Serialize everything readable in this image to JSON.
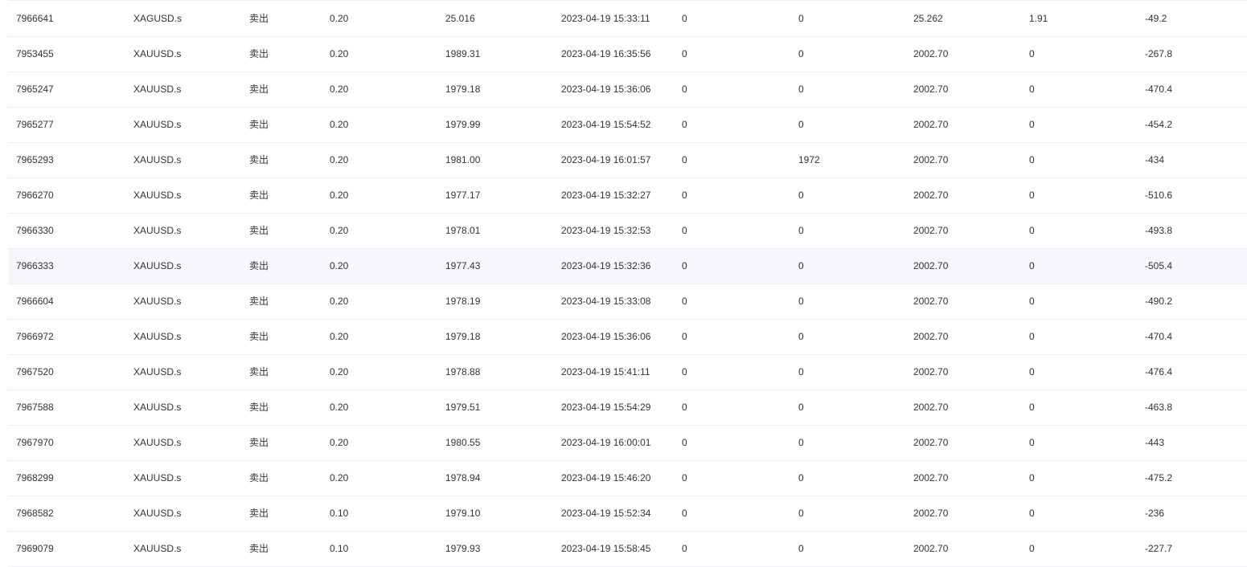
{
  "rows": [
    {
      "order": "7966641",
      "symbol": "XAGUSD.s",
      "side": "卖出",
      "volume": "0.20",
      "open_price": "25.016",
      "open_time": "2023-04-19 15:33:11",
      "sl": "0",
      "tp": "0",
      "current_price": "25.262",
      "swap": "1.91",
      "profit": "-49.2"
    },
    {
      "order": "7953455",
      "symbol": "XAUUSD.s",
      "side": "卖出",
      "volume": "0.20",
      "open_price": "1989.31",
      "open_time": "2023-04-19 16:35:56",
      "sl": "0",
      "tp": "0",
      "current_price": "2002.70",
      "swap": "0",
      "profit": "-267.8"
    },
    {
      "order": "7965247",
      "symbol": "XAUUSD.s",
      "side": "卖出",
      "volume": "0.20",
      "open_price": "1979.18",
      "open_time": "2023-04-19 15:36:06",
      "sl": "0",
      "tp": "0",
      "current_price": "2002.70",
      "swap": "0",
      "profit": "-470.4"
    },
    {
      "order": "7965277",
      "symbol": "XAUUSD.s",
      "side": "卖出",
      "volume": "0.20",
      "open_price": "1979.99",
      "open_time": "2023-04-19 15:54:52",
      "sl": "0",
      "tp": "0",
      "current_price": "2002.70",
      "swap": "0",
      "profit": "-454.2"
    },
    {
      "order": "7965293",
      "symbol": "XAUUSD.s",
      "side": "卖出",
      "volume": "0.20",
      "open_price": "1981.00",
      "open_time": "2023-04-19 16:01:57",
      "sl": "0",
      "tp": "1972",
      "current_price": "2002.70",
      "swap": "0",
      "profit": "-434"
    },
    {
      "order": "7966270",
      "symbol": "XAUUSD.s",
      "side": "卖出",
      "volume": "0.20",
      "open_price": "1977.17",
      "open_time": "2023-04-19 15:32:27",
      "sl": "0",
      "tp": "0",
      "current_price": "2002.70",
      "swap": "0",
      "profit": "-510.6"
    },
    {
      "order": "7966330",
      "symbol": "XAUUSD.s",
      "side": "卖出",
      "volume": "0.20",
      "open_price": "1978.01",
      "open_time": "2023-04-19 15:32:53",
      "sl": "0",
      "tp": "0",
      "current_price": "2002.70",
      "swap": "0",
      "profit": "-493.8"
    },
    {
      "order": "7966333",
      "symbol": "XAUUSD.s",
      "side": "卖出",
      "volume": "0.20",
      "open_price": "1977.43",
      "open_time": "2023-04-19 15:32:36",
      "sl": "0",
      "tp": "0",
      "current_price": "2002.70",
      "swap": "0",
      "profit": "-505.4",
      "hovered": true
    },
    {
      "order": "7966604",
      "symbol": "XAUUSD.s",
      "side": "卖出",
      "volume": "0.20",
      "open_price": "1978.19",
      "open_time": "2023-04-19 15:33:08",
      "sl": "0",
      "tp": "0",
      "current_price": "2002.70",
      "swap": "0",
      "profit": "-490.2"
    },
    {
      "order": "7966972",
      "symbol": "XAUUSD.s",
      "side": "卖出",
      "volume": "0.20",
      "open_price": "1979.18",
      "open_time": "2023-04-19 15:36:06",
      "sl": "0",
      "tp": "0",
      "current_price": "2002.70",
      "swap": "0",
      "profit": "-470.4"
    },
    {
      "order": "7967520",
      "symbol": "XAUUSD.s",
      "side": "卖出",
      "volume": "0.20",
      "open_price": "1978.88",
      "open_time": "2023-04-19 15:41:11",
      "sl": "0",
      "tp": "0",
      "current_price": "2002.70",
      "swap": "0",
      "profit": "-476.4"
    },
    {
      "order": "7967588",
      "symbol": "XAUUSD.s",
      "side": "卖出",
      "volume": "0.20",
      "open_price": "1979.51",
      "open_time": "2023-04-19 15:54:29",
      "sl": "0",
      "tp": "0",
      "current_price": "2002.70",
      "swap": "0",
      "profit": "-463.8"
    },
    {
      "order": "7967970",
      "symbol": "XAUUSD.s",
      "side": "卖出",
      "volume": "0.20",
      "open_price": "1980.55",
      "open_time": "2023-04-19 16:00:01",
      "sl": "0",
      "tp": "0",
      "current_price": "2002.70",
      "swap": "0",
      "profit": "-443"
    },
    {
      "order": "7968299",
      "symbol": "XAUUSD.s",
      "side": "卖出",
      "volume": "0.20",
      "open_price": "1978.94",
      "open_time": "2023-04-19 15:46:20",
      "sl": "0",
      "tp": "0",
      "current_price": "2002.70",
      "swap": "0",
      "profit": "-475.2"
    },
    {
      "order": "7968582",
      "symbol": "XAUUSD.s",
      "side": "卖出",
      "volume": "0.10",
      "open_price": "1979.10",
      "open_time": "2023-04-19 15:52:34",
      "sl": "0",
      "tp": "0",
      "current_price": "2002.70",
      "swap": "0",
      "profit": "-236"
    },
    {
      "order": "7969079",
      "symbol": "XAUUSD.s",
      "side": "卖出",
      "volume": "0.10",
      "open_price": "1979.93",
      "open_time": "2023-04-19 15:58:45",
      "sl": "0",
      "tp": "0",
      "current_price": "2002.70",
      "swap": "0",
      "profit": "-227.7"
    }
  ],
  "colors": {
    "text": "#333333",
    "row_border": "#ebeef5",
    "row_hover": "#f5f7fa"
  }
}
